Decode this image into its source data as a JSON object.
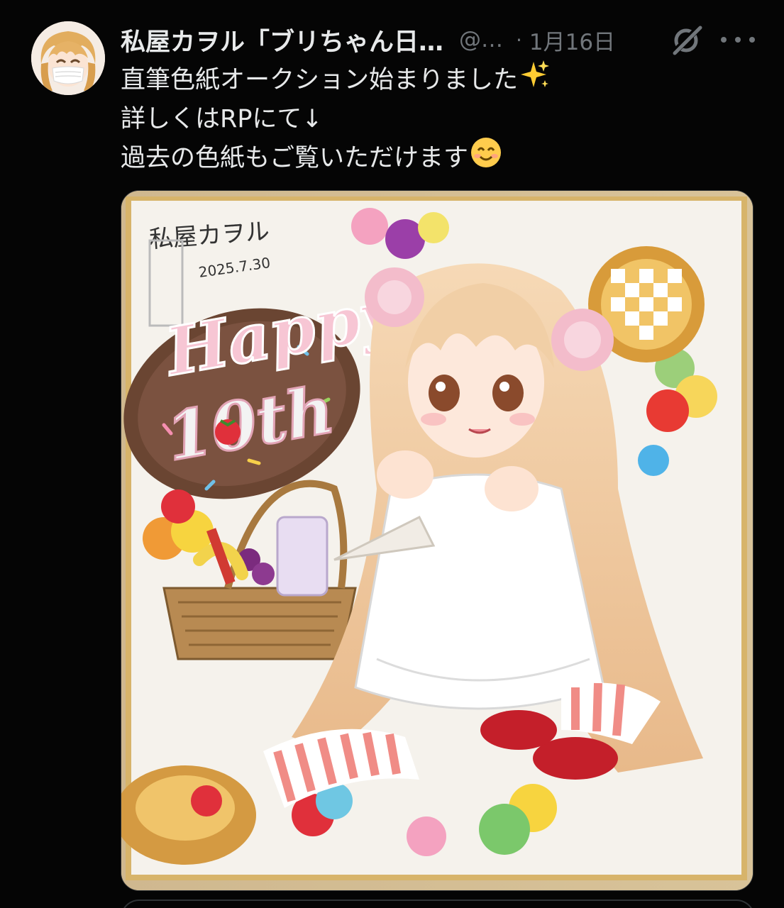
{
  "post": {
    "author": {
      "display_name": "私屋カヲル「ブリちゃん日…",
      "handle": "@…",
      "separator": "·",
      "date": "1月16日",
      "avatar_icon": "avatar-image"
    },
    "text_lines": [
      "直筆色紙オークション始まりました",
      "詳しくはRPにて↓",
      "過去の色紙もご覧いただけます"
    ],
    "emojis": {
      "sparkles": "sparkles-emoji",
      "smile": "smiling-face-emoji"
    },
    "media": {
      "artwork_text": "Happy 10th",
      "signature": "私屋カヲル",
      "signature_date": "2025.7.30"
    },
    "icons": {
      "grok": "grok-icon",
      "more": "more-options-icon"
    }
  },
  "colors": {
    "background": "#000000",
    "primary_text": "#e7e9ea",
    "secondary_text": "#71767b",
    "border": "#2f3336"
  }
}
